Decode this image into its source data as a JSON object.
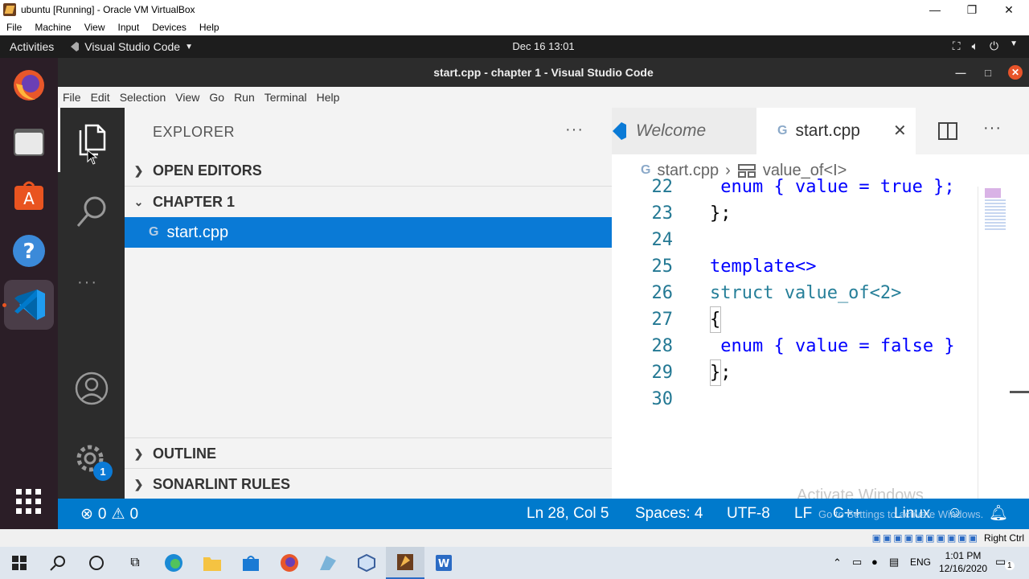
{
  "host_window": {
    "title": "ubuntu [Running] - Oracle VM VirtualBox",
    "menu": [
      "File",
      "Machine",
      "View",
      "Input",
      "Devices",
      "Help"
    ],
    "host_key_label": "Right Ctrl"
  },
  "ubuntu_topbar": {
    "activities": "Activities",
    "app_menu": "Visual Studio Code",
    "clock": "Dec 16  13:01"
  },
  "vscode": {
    "window_title": "start.cpp - chapter 1 - Visual Studio Code",
    "menu": [
      "File",
      "Edit",
      "Selection",
      "View",
      "Go",
      "Run",
      "Terminal",
      "Help"
    ],
    "settings_badge": "1",
    "explorer": {
      "header": "EXPLORER",
      "more": "···",
      "open_editors": "OPEN EDITORS",
      "folder": "CHAPTER 1",
      "selected_file": "start.cpp",
      "outline": "OUTLINE",
      "sonarlint": "SONARLINT RULES"
    },
    "tabs": [
      {
        "label": "Welcome",
        "active": false
      },
      {
        "label": "start.cpp",
        "active": true
      }
    ],
    "breadcrumb": {
      "file": "start.cpp",
      "symbol": "value_of<I>"
    },
    "code_lines": [
      {
        "n": "22",
        "text": " enum { value = true };"
      },
      {
        "n": "23",
        "text": "};"
      },
      {
        "n": "24",
        "text": ""
      },
      {
        "n": "25",
        "text": "template<>"
      },
      {
        "n": "26",
        "text": "struct value_of<2>"
      },
      {
        "n": "27",
        "text": "{"
      },
      {
        "n": "28",
        "text": " enum { value = false }"
      },
      {
        "n": "29",
        "text": "};"
      },
      {
        "n": "30",
        "text": ""
      }
    ],
    "status": {
      "errors": "0",
      "warnings": "0",
      "position": "Ln 28, Col 5",
      "spaces": "Spaces: 4",
      "encoding": "UTF-8",
      "eol": "LF",
      "language": "C++",
      "platform": "Linux"
    },
    "watermark": {
      "line1": "Activate Windows",
      "line2": "Go to Settings to activate Windows."
    }
  },
  "windows_taskbar": {
    "lang": "ENG",
    "time": "1:01 PM",
    "date": "12/16/2020",
    "notification_count": "1"
  },
  "colors": {
    "accent": "#007acc",
    "selection": "#0a7ad6",
    "dock": "#2b1e27"
  }
}
